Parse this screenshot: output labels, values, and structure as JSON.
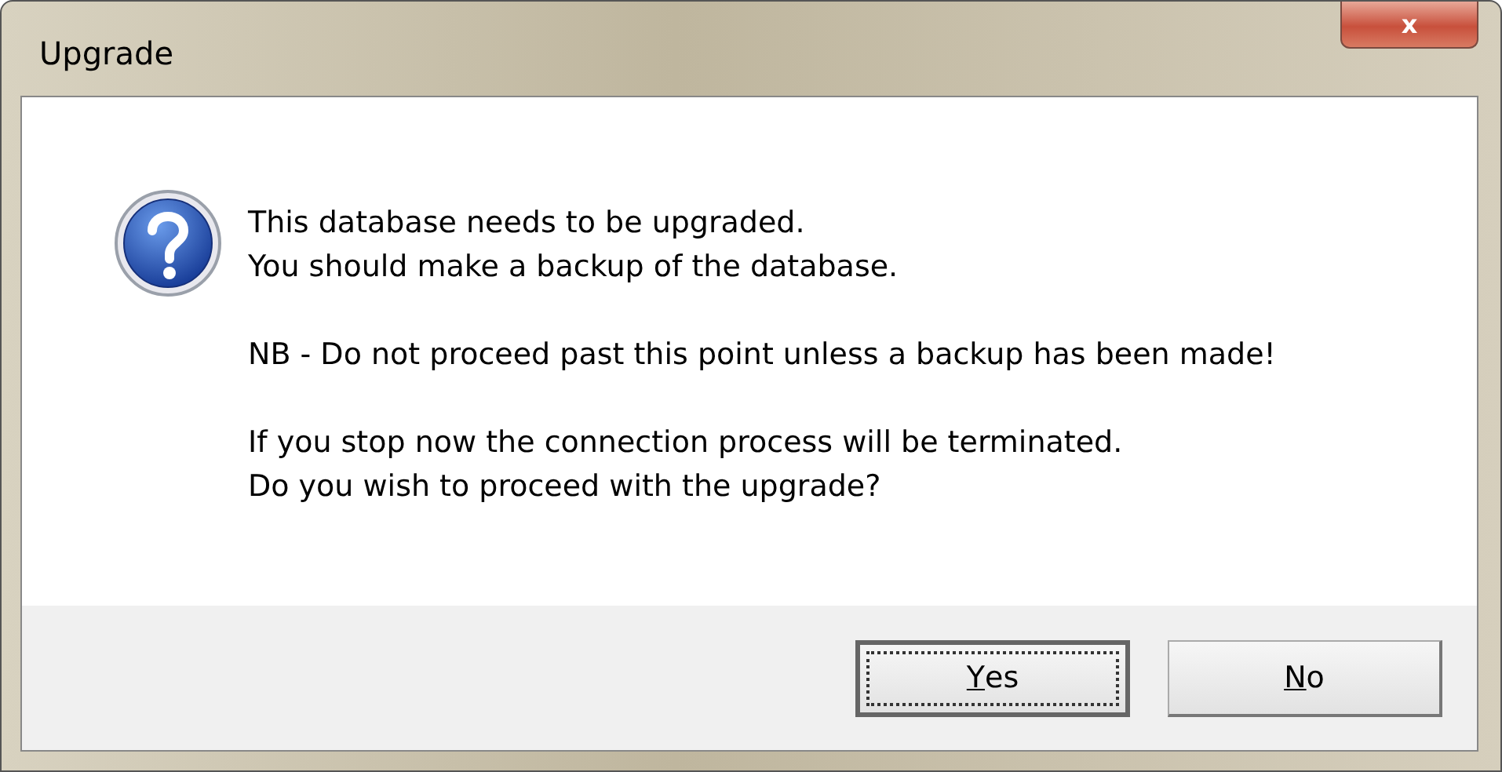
{
  "window": {
    "title": "Upgrade",
    "close_label": "x"
  },
  "message": {
    "paragraphs": [
      {
        "lines": [
          "This database needs to be upgraded.",
          "You should make a backup of the database."
        ]
      },
      {
        "lines": [
          "NB - Do not proceed past this point unless a backup has been made!"
        ]
      },
      {
        "lines": [
          "If you stop now the connection process will be terminated.",
          "Do you wish to proceed with the upgrade?"
        ]
      }
    ]
  },
  "buttons": [
    {
      "mnemonic": "Y",
      "rest": "es",
      "focused": true
    },
    {
      "mnemonic": "N",
      "rest": "o",
      "focused": false
    }
  ]
}
